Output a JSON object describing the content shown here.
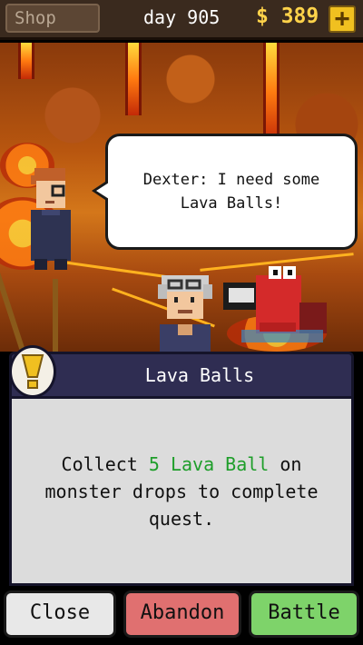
{
  "topbar": {
    "shop_label": "Shop",
    "day_label": "day 905",
    "money_label": "$ 389",
    "plus_label": "+"
  },
  "scene": {
    "speech": "Dexter: I need some Lava Balls!"
  },
  "quest": {
    "title": "Lava Balls",
    "desc_before": "Collect ",
    "desc_highlight": "5 Lava Ball",
    "desc_after": " on monster drops to complete quest."
  },
  "buttons": {
    "close": "Close",
    "abandon": "Abandon",
    "battle": "Battle"
  },
  "colors": {
    "highlight": "#1e9e2a",
    "money": "#ffd34a"
  }
}
